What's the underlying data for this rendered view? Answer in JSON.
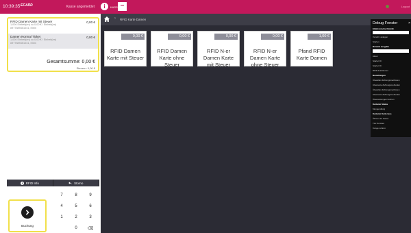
{
  "left": {
    "clock": "10:39:35",
    "brand": "ECARD",
    "register_label": "Kasse angemeldet",
    "cart": [
      {
        "name": "RFID Damen Karte mit Steuer",
        "price": "0,00 €",
        "detail1": "1,000 Einheit(en) zu 0,00 € / Einheit(en)",
        "detail2": "#977589451041, Klein"
      },
      {
        "name": "Damen Normal Ticket",
        "price": "0,00 €",
        "detail1": "1,000 Einheit(en) zu 0,00 € / Einheit(en)",
        "detail2": "#977589451041, Klein"
      }
    ],
    "total": "Gesamtsumme: 0,00 €",
    "tax": "Steuern: 0,00 €",
    "buttons": {
      "rfid_info": "RFID Info",
      "storno": "Storno"
    },
    "booking_label": "Buchung",
    "keys": [
      "7",
      "8",
      "9",
      "4",
      "5",
      "6",
      "1",
      "2",
      "3",
      "0",
      "⌫"
    ]
  },
  "topbar": {
    "user_label": "KASSE",
    "right_label": "Logout"
  },
  "breadcrumb": {
    "item": "RFID Karte Damen"
  },
  "products": [
    {
      "price": "0,00 €",
      "name": "RFID Damen Karte mit Steuer"
    },
    {
      "price": "0,00 €",
      "name": "RFID Damen Karte ohne Steuer"
    },
    {
      "price": "0,00 €",
      "name": "RFID N-er Damen Karte mit Steuer"
    },
    {
      "price": "0,00 €",
      "name": "RFID N-er Damen Karte ohne Steuer"
    },
    {
      "price": "1,00 €",
      "name": "Pfand RFID Karte Damen"
    }
  ],
  "debug": {
    "title": "Debug Fenster",
    "close": "×",
    "items": [
      {
        "t": "Elektronische Notizbl.",
        "sec": true
      },
      {
        "t": "Vorschl. anlegen",
        "sec": false
      },
      {
        "t": "Starten",
        "sec": false
      },
      {
        "t": "Bereich ausgabe",
        "sec": true
      },
      {
        "t": "Menü",
        "sec": true
      },
      {
        "t": "Akten",
        "sec": false
      },
      {
        "t": "Starter ID",
        "sec": false
      },
      {
        "t": "Starter ID",
        "sec": false
      },
      {
        "t": "RFID-Funktionen",
        "sec": false
      },
      {
        "t": "Bestellungen",
        "sec": true
      },
      {
        "t": "Überallen Zahlungsmethoden",
        "sec": false
      },
      {
        "t": "Uberweite Zahlungsmethoden",
        "sec": false
      },
      {
        "t": "Überallen Zahlungsmethoden",
        "sec": false
      },
      {
        "t": "Uberweite Zahlungsmethoden",
        "sec": false
      },
      {
        "t": "Überweisungen buchen",
        "sec": false
      },
      {
        "t": "Kartenm Status",
        "sec": true
      },
      {
        "t": "Mengendlung",
        "sec": false
      },
      {
        "t": "Kartenm Karte laos",
        "sec": true
      },
      {
        "t": "Öffnen der Kasse",
        "sec": false
      },
      {
        "t": "Tisc Sonstes",
        "sec": false
      },
      {
        "t": "Konge Lohren",
        "sec": false
      }
    ]
  },
  "colors": {
    "accent": "#c2185b",
    "highlight": "#f1e04a",
    "dark_bg": "#2b2b34"
  }
}
